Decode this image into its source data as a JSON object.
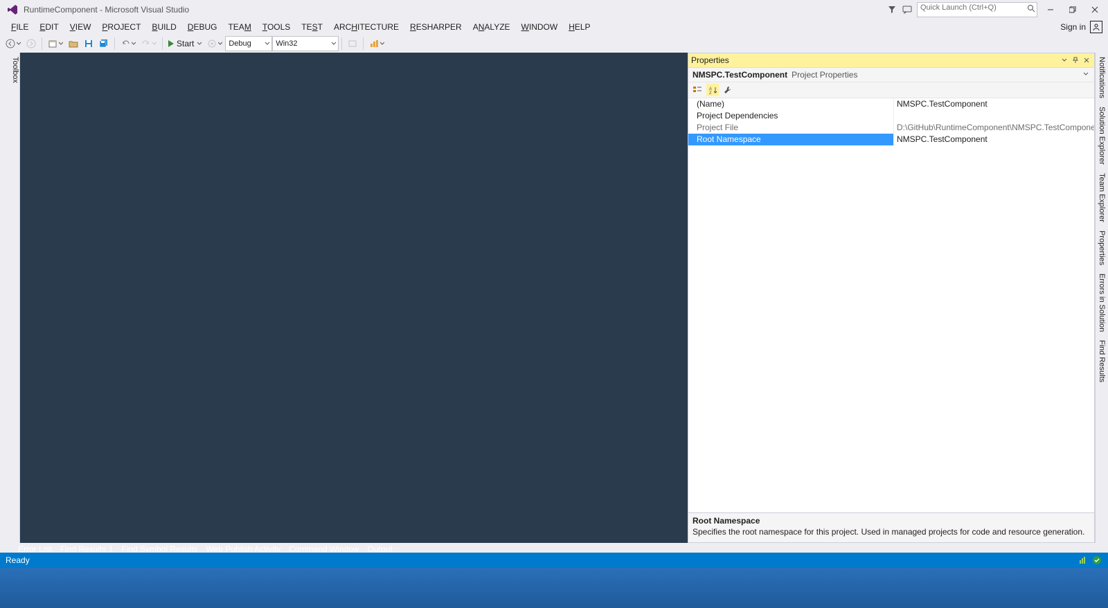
{
  "title": "RuntimeComponent - Microsoft Visual Studio",
  "quicklaunch_placeholder": "Quick Launch (Ctrl+Q)",
  "menu": {
    "file": "FILE",
    "edit": "EDIT",
    "view": "VIEW",
    "project": "PROJECT",
    "build": "BUILD",
    "debug": "DEBUG",
    "team": "TEAM",
    "tools": "TOOLS",
    "test": "TEST",
    "architecture": "ARCHITECTURE",
    "resharper": "RESHARPER",
    "analyze": "ANALYZE",
    "window": "WINDOW",
    "help": "HELP",
    "signin": "Sign in"
  },
  "toolbar": {
    "start": "Start",
    "config": "Debug",
    "platform": "Win32"
  },
  "left_tab": "Toolbox",
  "right_tabs": [
    "Notifications",
    "Solution Explorer",
    "Team Explorer",
    "Properties",
    "Errors in Solution",
    "Find Results"
  ],
  "properties": {
    "panel_title": "Properties",
    "object_name": "NMSPC.TestComponent",
    "object_type": "Project Properties",
    "rows": [
      {
        "name": "(Name)",
        "value": "NMSPC.TestComponent",
        "dimmed": false,
        "selected": false
      },
      {
        "name": "Project Dependencies",
        "value": "",
        "dimmed": false,
        "selected": false
      },
      {
        "name": "Project File",
        "value": "D:\\GitHub\\RuntimeComponent\\NMSPC.TestComponent\\NMSPC.TestCo",
        "dimmed": true,
        "selected": false
      },
      {
        "name": "Root Namespace",
        "value": "NMSPC.TestComponent",
        "dimmed": false,
        "selected": true
      }
    ],
    "desc_title": "Root Namespace",
    "desc_text": "Specifies the root namespace for this project.  Used in managed projects for code and resource generation."
  },
  "bottom_tabs": [
    "Error List",
    "Find Results 1",
    "Find Symbol Results",
    "Web Publish Activity",
    "Command Window",
    "Output"
  ],
  "status": "Ready"
}
